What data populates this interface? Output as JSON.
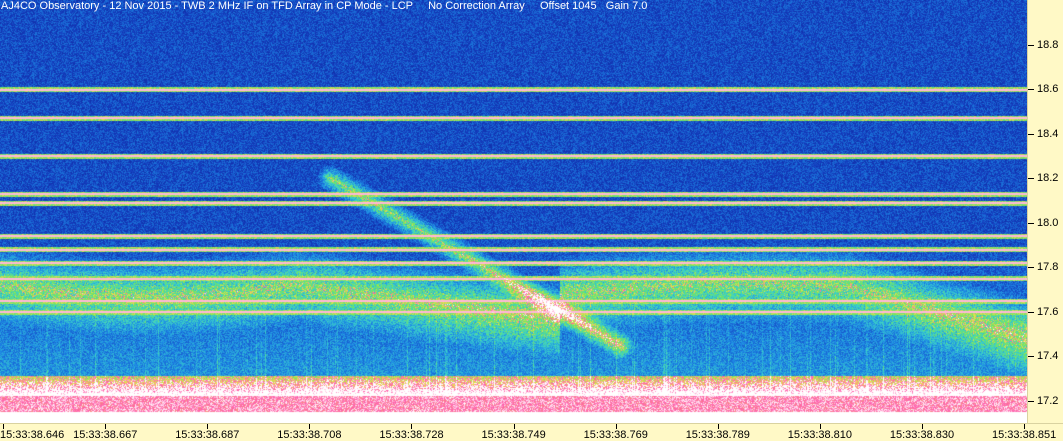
{
  "title": {
    "text": "AJ4CO Observatory - 12 Nov 2015 - TWB 2 MHz IF on TFD Array in CP Mode - LCP     No Correction Array     Offset 1045   Gain 7.0"
  },
  "y_axis": {
    "unit": "MHz",
    "range": [
      17.1,
      19.0
    ],
    "ticks": [
      "18.8",
      "18.6",
      "18.4",
      "18.2",
      "18.0",
      "17.8",
      "17.6",
      "17.4",
      "17.2"
    ]
  },
  "x_axis": {
    "ticks": [
      "15:33:38.646",
      "15:33:38.667",
      "15:33:38.687",
      "15:33:38.708",
      "15:33:38.728",
      "15:33:38.749",
      "15:33:38.769",
      "15:33:38.789",
      "15:33:38.810",
      "15:33:38.830",
      "15:33:38.851"
    ]
  },
  "colors": {
    "background_low": "#0b1f8f",
    "mid": "#2aa0e0",
    "high": "#6fe06a",
    "peak": "#ff4da0",
    "axis_bg": "#fff9c6",
    "axis_text": "#000000"
  },
  "interference_lines_mhz": [
    18.6,
    18.47,
    18.3,
    18.13,
    18.09,
    17.94,
    17.88,
    17.82,
    17.75,
    17.65,
    17.6
  ]
}
